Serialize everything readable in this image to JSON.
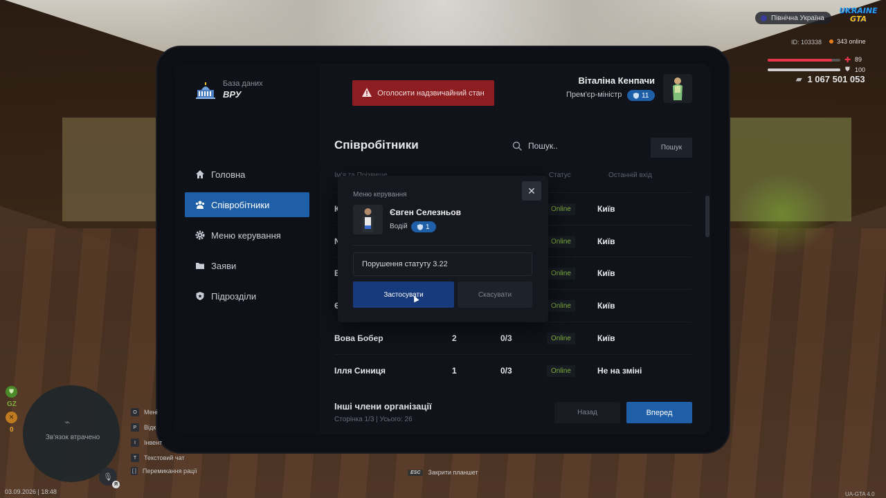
{
  "hud": {
    "region": "Північна Україна",
    "logo_top": "UKRAINE",
    "logo_bottom": "GTA",
    "id_text": "ID: 103338",
    "online_text": "343 online",
    "health": "89",
    "armor": "100",
    "money": "1 067 501 053",
    "colors": {
      "health": "#e8344a",
      "armor": "#d0d0d0"
    }
  },
  "left_hud": {
    "gz_label": "GZ",
    "zero_label": "0",
    "minimap_status": "Зв'язок втрачено",
    "mic_key": "Я",
    "date": "03.09.2026 | 18:48",
    "hotkeys": [
      {
        "key": "O",
        "label": "Мені"
      },
      {
        "key": "P",
        "label": "Відк"
      },
      {
        "key": "I",
        "label": "Інвент"
      },
      {
        "key": "T",
        "label": "Текстовий чат"
      },
      {
        "key": "[ ]",
        "label": "Перемикання рації"
      }
    ]
  },
  "footer": {
    "esc_key": "ESC",
    "esc_label": "Закрити планшет",
    "version": "UA-GTA 4.0"
  },
  "tablet": {
    "brand_sub": "База даних",
    "brand_title": "ВРУ",
    "alert_button": "Оголосити надзвичайний стан",
    "user": {
      "name": "Віталіна Кенпачи",
      "role": "Прем'єр-міністр",
      "rank": "11"
    },
    "nav": [
      {
        "label": "Головна",
        "icon": "home-icon"
      },
      {
        "label": "Співробітники",
        "icon": "users-icon",
        "active": true
      },
      {
        "label": "Меню керування",
        "icon": "gear-icon"
      },
      {
        "label": "Заяви",
        "icon": "folder-icon"
      },
      {
        "label": "Підрозділи",
        "icon": "shield-icon"
      }
    ],
    "page_title": "Співробітники",
    "search_placeholder": "Пошук..",
    "search_button": "Пошук",
    "columns": {
      "name": "Ім'я та Прізвище",
      "status": "Статус",
      "last_login": "Останній вхід"
    },
    "rows": [
      {
        "name": "К",
        "rank": "",
        "warns": "",
        "status": "Online",
        "last": "Київ"
      },
      {
        "name": "N",
        "rank": "",
        "warns": "",
        "status": "Online",
        "last": "Київ"
      },
      {
        "name": "В",
        "rank": "",
        "warns": "",
        "status": "Online",
        "last": "Київ"
      },
      {
        "name": "Є",
        "rank": "",
        "warns": "",
        "status": "Online",
        "last": "Київ"
      },
      {
        "name": "Вова Бобер",
        "rank": "2",
        "warns": "0/3",
        "status": "Online",
        "last": "Київ"
      },
      {
        "name": "Ілля Синиця",
        "rank": "1",
        "warns": "0/3",
        "status": "Online",
        "last": "Не на зміні"
      }
    ],
    "others_title": "Інші члени організації",
    "others_sub": "Сторінка 1/3 | Усього: 26",
    "back_button": "Назад",
    "next_button": "Вперед"
  },
  "modal": {
    "label": "Меню керування",
    "close": "✕",
    "name": "Євген Селезньов",
    "role": "Водій",
    "rank": "1",
    "reason": "Порушення статуту 3.22",
    "apply": "Застосувати",
    "cancel": "Скасувати"
  }
}
